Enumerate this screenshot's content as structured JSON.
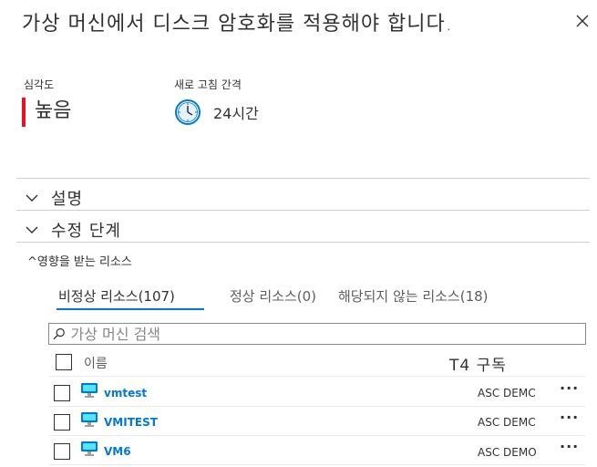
{
  "header": {
    "title": "가상 머신에서 디스크 암호화를 적용해야 합니다."
  },
  "severity": {
    "label": "심각도",
    "value": "높음",
    "color": "#e81123"
  },
  "freshness": {
    "label": "새로 고침 간격",
    "value": "24시간",
    "icon": "clock-icon"
  },
  "sections": {
    "description": "설명",
    "remediation": "수정 단계"
  },
  "affected": {
    "label": "^영향을 받는 리소스"
  },
  "tabs": [
    {
      "label": "비정상 리소스(107)",
      "active": true
    },
    {
      "label": "정상 리소스(0)",
      "active": false
    },
    {
      "label": "해당되지 않는 리소스(18)",
      "active": false
    }
  ],
  "search": {
    "placeholder": "가상 머신 검색"
  },
  "table": {
    "columns": {
      "name": "이름",
      "subscription": "T4 구독"
    },
    "rows": [
      {
        "name": "vmtest",
        "subscription": "ASC DEMC",
        "more": "···"
      },
      {
        "name": "VMITEST",
        "subscription": "ASC DEMC",
        "more": "···"
      },
      {
        "name": "VM6",
        "subscription": "ASC DEMO",
        "more": "···"
      }
    ]
  },
  "colors": {
    "accent": "#0078d4",
    "severity_high": "#e81123"
  }
}
